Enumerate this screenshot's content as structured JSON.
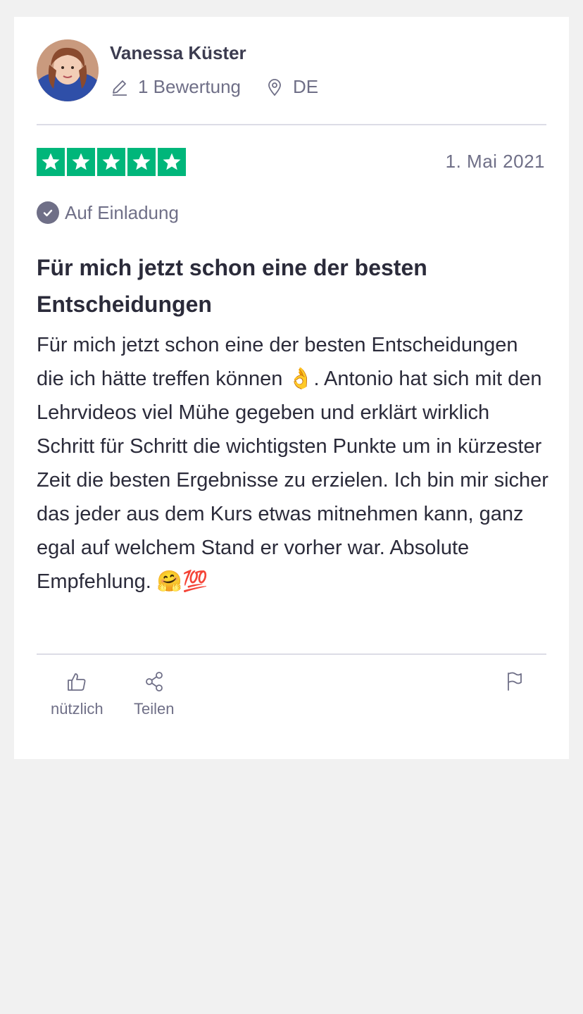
{
  "reviewer": {
    "name": "Vanessa Küster",
    "reviews_count_label": "1 Bewertung",
    "country": "DE",
    "pencil_icon": "pencil-icon",
    "location_icon": "location-pin-icon"
  },
  "review": {
    "rating": 5,
    "max_rating": 5,
    "star_color": "#00b67a",
    "date": "1. Mai 2021",
    "invite_label": "Auf Einladung",
    "title": "Für mich jetzt schon eine der besten Entscheidungen",
    "body": "Für mich jetzt schon eine der besten Entscheidungen die ich hätte treffen können 👌. Antonio hat sich mit den Lehrvideos viel Mühe gegeben und erklärt wirklich Schritt für Schritt die wichtigsten Punkte um in kürzester Zeit die besten Ergebnisse zu erzielen. Ich bin mir sicher das jeder aus dem Kurs etwas mitnehmen kann, ganz egal auf welchem Stand er vorher war. Absolute Empfehlung. 🤗💯"
  },
  "actions": {
    "useful_label": "nützlich",
    "share_label": "Teilen",
    "flag_icon": "flag-icon"
  }
}
